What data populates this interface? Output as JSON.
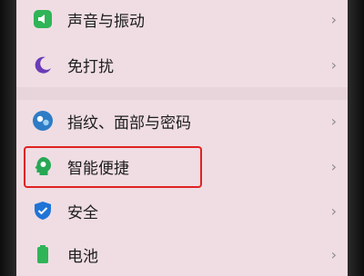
{
  "settings": {
    "items": [
      {
        "label": "声音与振动",
        "icon": "speaker-icon",
        "icon_color": "#2fb457"
      },
      {
        "label": "免打扰",
        "icon": "moon-icon",
        "icon_color": "#6a3bb8"
      },
      {
        "label": "指纹、面部与密码",
        "icon": "fingerprint-face-icon",
        "icon_color": "#2e7cc6"
      },
      {
        "label": "智能便捷",
        "icon": "smart-assist-icon",
        "icon_color": "#26a855"
      },
      {
        "label": "安全",
        "icon": "shield-icon",
        "icon_color": "#1f74d6"
      },
      {
        "label": "电池",
        "icon": "battery-icon",
        "icon_color": "#2fb457"
      }
    ],
    "chevron": "›"
  },
  "annotation": {
    "highlight_color": "#e02222"
  }
}
